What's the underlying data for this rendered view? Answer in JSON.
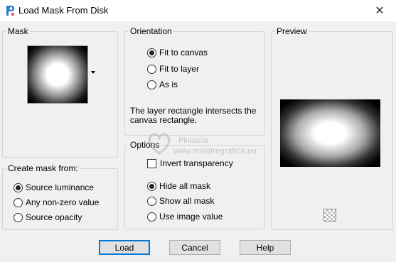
{
  "window": {
    "title": "Load Mask From Disk",
    "close_glyph": "✕",
    "icon": "app-icon"
  },
  "mask": {
    "label": "Mask"
  },
  "create_mask_from": {
    "label": "Create mask from:",
    "options": [
      "Source luminance",
      "Any non-zero value",
      "Source opacity"
    ],
    "selected": "Source luminance"
  },
  "orientation": {
    "label": "Orientation",
    "options": [
      "Fit to canvas",
      "Fit to layer",
      "As is"
    ],
    "selected": "Fit to canvas",
    "info": "The layer rectangle intersects the canvas rectangle."
  },
  "options": {
    "label": "Options",
    "invert_transparency": "Invert transparency",
    "invert_checked": false,
    "visibility": [
      "Hide all mask",
      "Show all mask",
      "Use image value"
    ],
    "selected": "Hide all mask"
  },
  "preview": {
    "label": "Preview"
  },
  "watermark": {
    "name": "Pinuccia",
    "url": "www.maidiregrafica.eu"
  },
  "buttons": {
    "load": "Load",
    "cancel": "Cancel",
    "help": "Help"
  }
}
